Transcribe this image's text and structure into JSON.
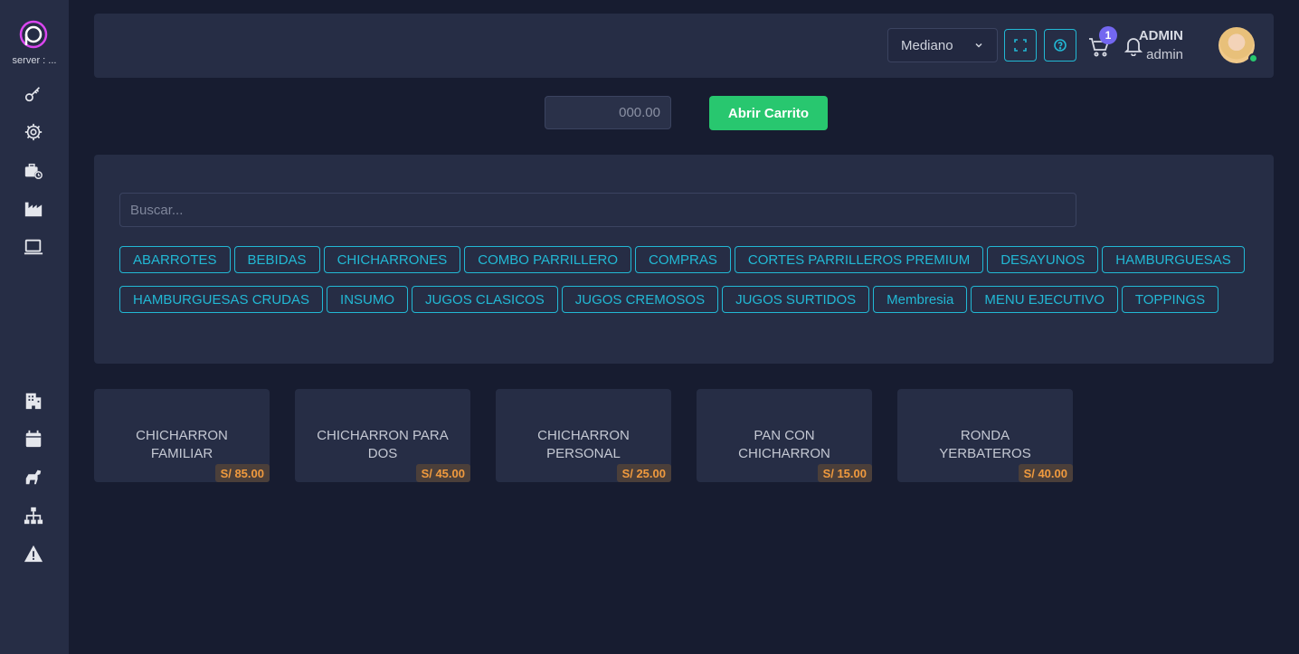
{
  "sidebar": {
    "server_label": "server : ...",
    "top_icons": [
      "key-icon",
      "gear-icon",
      "briefcase-clock-icon",
      "factory-icon",
      "laptop-icon"
    ],
    "bottom_icons": [
      "building-icon",
      "calendar-icon",
      "horse-icon",
      "sitemap-icon",
      "warning-icon"
    ]
  },
  "header": {
    "size_select": "Mediano",
    "cart_count": "1",
    "user_name": "ADMIN",
    "user_role": "admin"
  },
  "toolbar": {
    "amount_placeholder": "000.00",
    "open_cart_label": "Abrir Carrito"
  },
  "search": {
    "placeholder": "Buscar..."
  },
  "categories": {
    "row1": [
      "ABARROTES",
      "BEBIDAS",
      "CHICHARRONES",
      "COMBO PARRILLERO",
      "COMPRAS",
      "CORTES PARRILLEROS PREMIUM",
      "DESAYUNOS",
      "HAMBURGUESAS"
    ],
    "row2": [
      "HAMBURGUESAS CRUDAS",
      "INSUMO",
      "JUGOS CLASICOS",
      "JUGOS CREMOSOS",
      "JUGOS SURTIDOS",
      "Membresia",
      "MENU EJECUTIVO",
      "TOPPINGS"
    ]
  },
  "products": [
    {
      "name_line1": "CHICHARRON",
      "name_line2": "FAMILIAR",
      "price": "S/ 85.00"
    },
    {
      "name_line1": "CHICHARRON PARA",
      "name_line2": "DOS",
      "price": "S/ 45.00"
    },
    {
      "name_line1": "CHICHARRON",
      "name_line2": "PERSONAL",
      "price": "S/ 25.00"
    },
    {
      "name_line1": "PAN CON",
      "name_line2": "CHICHARRON",
      "price": "S/ 15.00"
    },
    {
      "name_line1": "RONDA",
      "name_line2": "YERBATEROS",
      "price": "S/ 40.00"
    }
  ],
  "colors": {
    "accent": "#22b8d4",
    "success": "#28c76f",
    "price": "#f09a3e",
    "badge": "#7367f0"
  }
}
